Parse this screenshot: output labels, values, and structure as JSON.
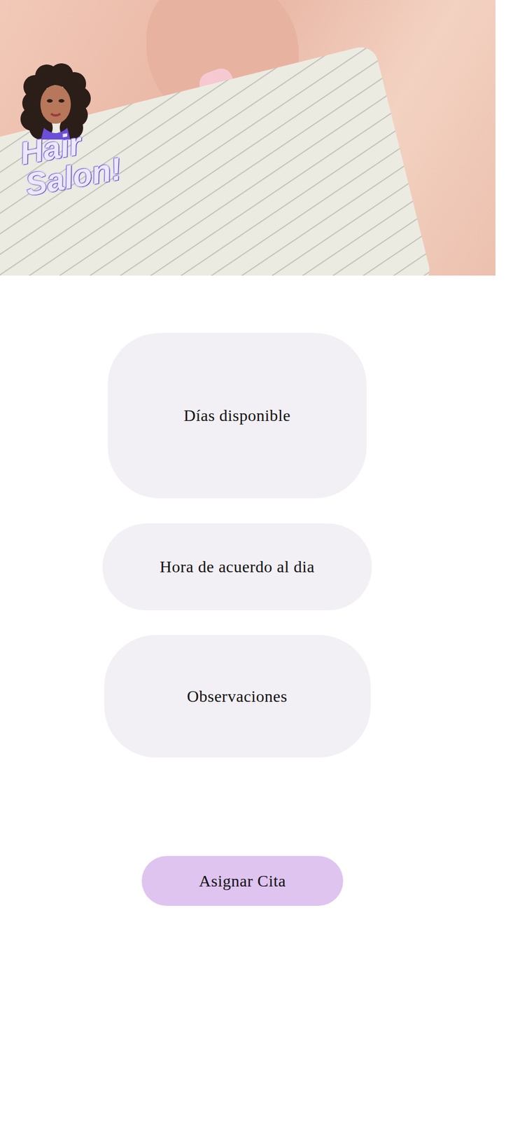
{
  "hero": {
    "logo": "Hair Salon!"
  },
  "fields": [
    {
      "label": "Días disponible"
    },
    {
      "label": "Hora de acuerdo al dia"
    },
    {
      "label": "Observaciones"
    }
  ],
  "button": "Asignar Cita"
}
